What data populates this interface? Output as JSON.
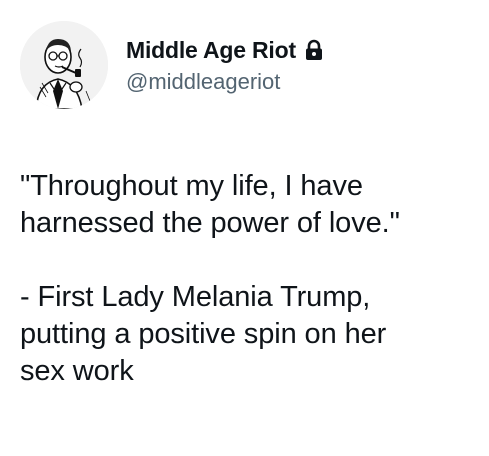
{
  "author": {
    "display_name": "Middle Age Riot",
    "handle": "@middleageriot",
    "avatar_icon": "man-with-pipe-avatar",
    "protected_icon": "lock-icon"
  },
  "tweet": {
    "text": "\"Throughout my life, I have\nharnessed the power of love.\"\n\n- First Lady Melania Trump,\nputting a positive spin on her\nsex work"
  },
  "colors": {
    "text": "#0f1419",
    "secondary": "#536471",
    "background": "#ffffff"
  }
}
